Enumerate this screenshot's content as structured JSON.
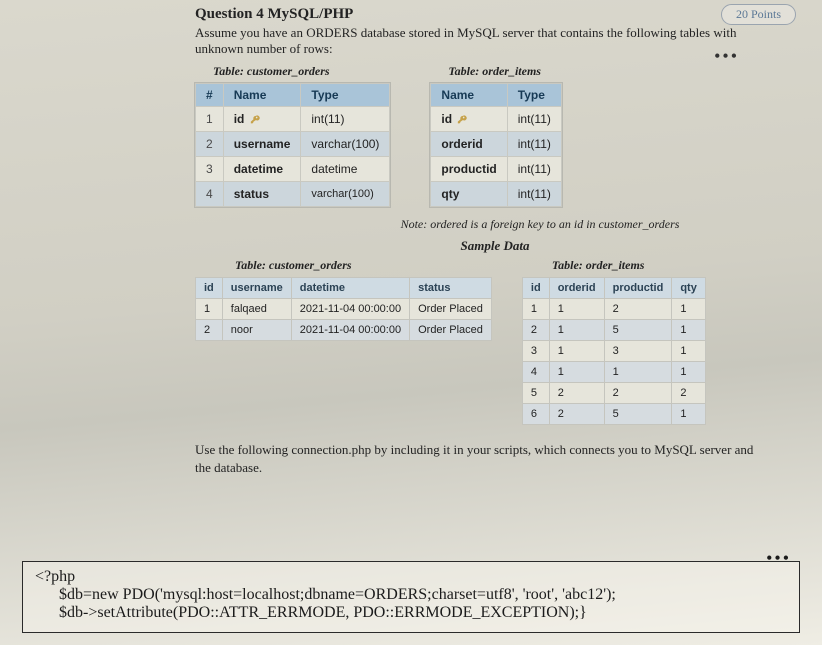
{
  "points_badge": "20 Points",
  "question_title": "Question 4 MySQL/PHP",
  "intro": "Assume you have an ORDERS database stored in MySQL server that contains the following tables with unknown number of rows:",
  "more_dots": "•••",
  "schema_left": {
    "caption": "Table: customer_orders",
    "head": {
      "num": "#",
      "name": "Name",
      "type": "Type"
    },
    "rows": [
      {
        "num": "1",
        "name": "id",
        "type": "int(11)",
        "pk": true
      },
      {
        "num": "2",
        "name": "username",
        "type": "varchar(100)"
      },
      {
        "num": "3",
        "name": "datetime",
        "type": "datetime"
      },
      {
        "num": "4",
        "name": "status",
        "type": "varchar(100)",
        "cursor": true
      }
    ]
  },
  "schema_right": {
    "caption": "Table: order_items",
    "head": {
      "name": "Name",
      "type": "Type"
    },
    "rows": [
      {
        "name": "id",
        "type": "int(11)",
        "pk": true
      },
      {
        "name": "orderid",
        "type": "int(11)"
      },
      {
        "name": "productid",
        "type": "int(11)"
      },
      {
        "name": "qty",
        "type": "int(11)"
      }
    ]
  },
  "fk_note": "Note: ordered is a foreign key to an id in customer_orders",
  "sample_title": "Sample Data",
  "sample_left": {
    "caption": "Table: customer_orders",
    "head": {
      "id": "id",
      "username": "username",
      "datetime": "datetime",
      "status": "status"
    },
    "rows": [
      {
        "id": "1",
        "username": "falqaed",
        "datetime": "2021-11-04 00:00:00",
        "status": "Order Placed"
      },
      {
        "id": "2",
        "username": "noor",
        "datetime": "2021-11-04 00:00:00",
        "status": "Order Placed"
      }
    ]
  },
  "sample_right": {
    "caption": "Table: order_items",
    "head": {
      "id": "id",
      "orderid": "orderid",
      "productid": "productid",
      "qty": "qty"
    },
    "rows": [
      {
        "id": "1",
        "orderid": "1",
        "productid": "2",
        "qty": "1"
      },
      {
        "id": "2",
        "orderid": "1",
        "productid": "5",
        "qty": "1"
      },
      {
        "id": "3",
        "orderid": "1",
        "productid": "3",
        "qty": "1"
      },
      {
        "id": "4",
        "orderid": "1",
        "productid": "1",
        "qty": "1"
      },
      {
        "id": "5",
        "orderid": "2",
        "productid": "2",
        "qty": "2"
      },
      {
        "id": "6",
        "orderid": "2",
        "productid": "5",
        "qty": "1"
      }
    ]
  },
  "connection_instr": "Use the following connection.php by including it in your scripts, which connects you to MySQL server and the database.",
  "code": {
    "l1": "<?php",
    "l2": "      $db=new PDO('mysql:host=localhost;dbname=ORDERS;charset=utf8', 'root', 'abc12');",
    "l3": "      $db->setAttribute(PDO::ATTR_ERRMODE, PDO::ERRMODE_EXCEPTION);}"
  }
}
